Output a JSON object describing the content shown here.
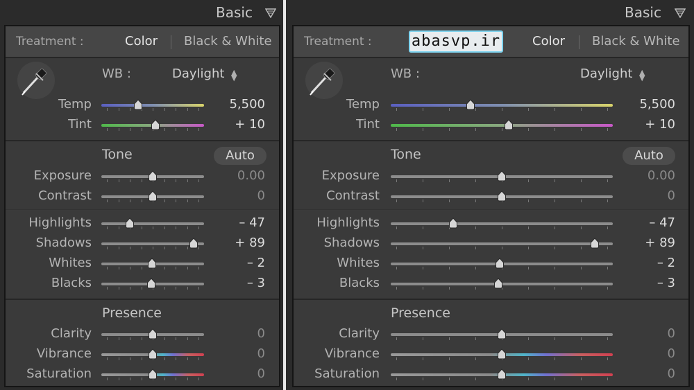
{
  "panels": [
    {
      "title": "Basic",
      "watermark": "",
      "treatment": {
        "label": "Treatment :",
        "color": "Color",
        "bw": "Black & White"
      },
      "wb": {
        "label": "WB :",
        "value": "Daylight"
      },
      "temp": {
        "label": "Temp",
        "value": "5,500",
        "position": 0.36
      },
      "tint": {
        "label": "Tint",
        "value": "+ 10",
        "position": 0.53
      },
      "tone_title": "Tone",
      "auto_label": "Auto",
      "exposure": {
        "label": "Exposure",
        "value": "0.00",
        "position": 0.5
      },
      "contrast": {
        "label": "Contrast",
        "value": "0",
        "position": 0.5
      },
      "highlights": {
        "label": "Highlights",
        "value": "– 47",
        "position": 0.28
      },
      "shadows": {
        "label": "Shadows",
        "value": "+ 89",
        "position": 0.9
      },
      "whites": {
        "label": "Whites",
        "value": "– 2",
        "position": 0.49
      },
      "blacks": {
        "label": "Blacks",
        "value": "– 3",
        "position": 0.485
      },
      "presence_title": "Presence",
      "clarity": {
        "label": "Clarity",
        "value": "0",
        "position": 0.5
      },
      "vibrance": {
        "label": "Vibrance",
        "value": "0",
        "position": 0.5
      },
      "saturation": {
        "label": "Saturation",
        "value": "0",
        "position": 0.5
      }
    },
    {
      "title": "Basic",
      "watermark": "abasvp.ir",
      "treatment": {
        "label": "Treatment :",
        "color": "Color",
        "bw": "Black & White"
      },
      "wb": {
        "label": "WB :",
        "value": "Daylight"
      },
      "temp": {
        "label": "Temp",
        "value": "5,500",
        "position": 0.36
      },
      "tint": {
        "label": "Tint",
        "value": "+ 10",
        "position": 0.53
      },
      "tone_title": "Tone",
      "auto_label": "Auto",
      "exposure": {
        "label": "Exposure",
        "value": "0.00",
        "position": 0.5
      },
      "contrast": {
        "label": "Contrast",
        "value": "0",
        "position": 0.5
      },
      "highlights": {
        "label": "Highlights",
        "value": "– 47",
        "position": 0.28
      },
      "shadows": {
        "label": "Shadows",
        "value": "+ 89",
        "position": 0.92
      },
      "whites": {
        "label": "Whites",
        "value": "– 2",
        "position": 0.49
      },
      "blacks": {
        "label": "Blacks",
        "value": "– 3",
        "position": 0.485
      },
      "presence_title": "Presence",
      "clarity": {
        "label": "Clarity",
        "value": "0",
        "position": 0.5
      },
      "vibrance": {
        "label": "Vibrance",
        "value": "0",
        "position": 0.5
      },
      "saturation": {
        "label": "Saturation",
        "value": "0",
        "position": 0.5
      }
    }
  ],
  "icons": {
    "collapse": "triangle-down-icon",
    "dropper": "eyedropper-icon",
    "wb_arrows": "up-down-arrows-icon"
  },
  "colors": {
    "panel_bg": "#3a3a3a",
    "header_bg": "#2b2b2b",
    "divider": "#e8e8e8"
  }
}
